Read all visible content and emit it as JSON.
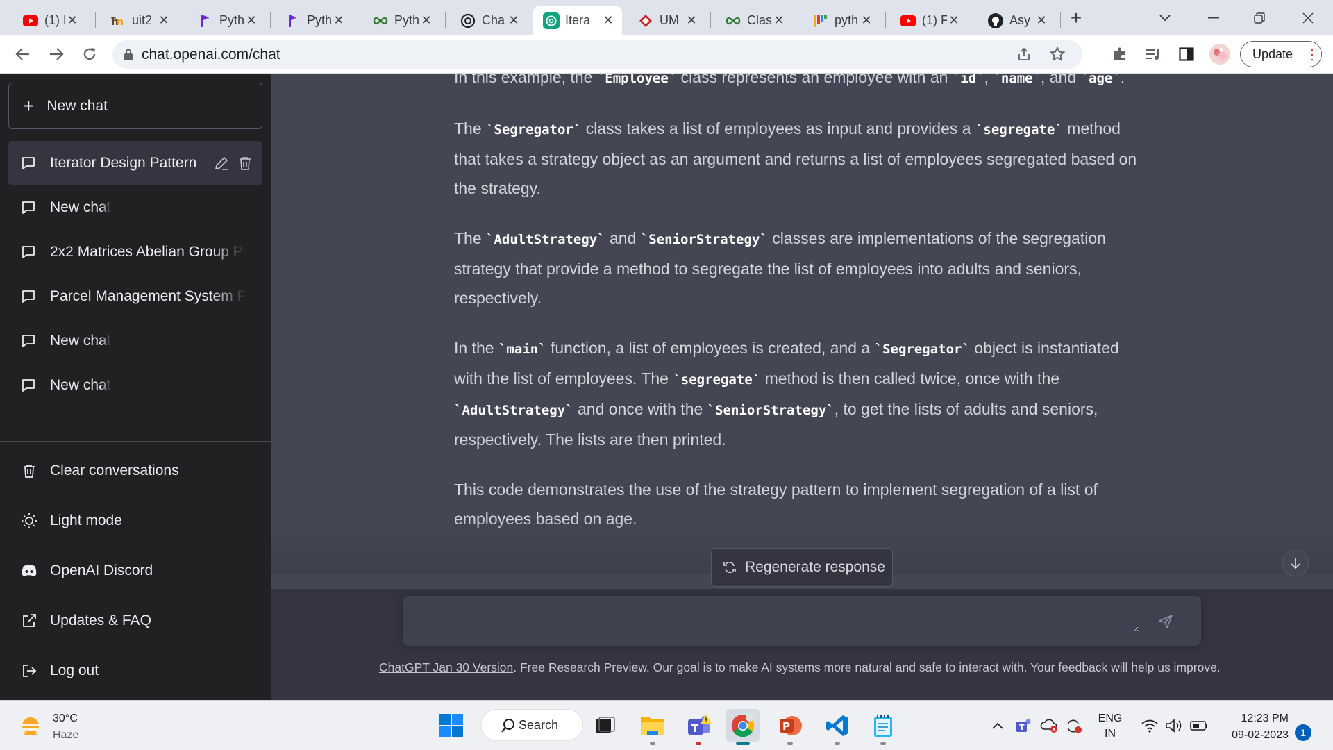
{
  "browser": {
    "tabs": [
      {
        "title": "(1) F",
        "icon": "youtube-icon"
      },
      {
        "title": "uit2",
        "icon": "hugging-face-icon"
      },
      {
        "title": "Pyth",
        "icon": "p-logo-icon"
      },
      {
        "title": "Pyth",
        "icon": "p-logo-icon"
      },
      {
        "title": "Pyth",
        "icon": "infinity-icon"
      },
      {
        "title": "Cha",
        "icon": "openai-icon"
      },
      {
        "title": "Itera",
        "icon": "openai-icon",
        "active": true
      },
      {
        "title": "UM",
        "icon": "diamond-icon"
      },
      {
        "title": "Clas",
        "icon": "infinity-icon"
      },
      {
        "title": "pyth",
        "icon": "colorful-bars-icon"
      },
      {
        "title": "(1) F",
        "icon": "youtube-icon"
      },
      {
        "title": "Asy",
        "icon": "github-icon"
      }
    ],
    "url": "chat.openai.com/chat",
    "update_label": "Update"
  },
  "sidebar": {
    "new_chat_label": "New chat",
    "history": [
      {
        "label": "Iterator Design Pattern",
        "active": true
      },
      {
        "label": "New chat"
      },
      {
        "label": "2x2 Matrices Abelian Group Pr"
      },
      {
        "label": "Parcel Management System Py"
      },
      {
        "label": "New chat"
      },
      {
        "label": "New chat"
      }
    ],
    "options": [
      {
        "label": "Clear conversations",
        "icon": "trash-icon"
      },
      {
        "label": "Light mode",
        "icon": "sun-icon"
      },
      {
        "label": "OpenAI Discord",
        "icon": "discord-icon"
      },
      {
        "label": "Updates & FAQ",
        "icon": "external-link-icon"
      },
      {
        "label": "Log out",
        "icon": "logout-icon"
      }
    ]
  },
  "response": {
    "p0": {
      "a": "In this example, the ",
      "c1": "`Employee`",
      "b": " class represents an employee with an ",
      "c2": "`id`",
      "d": ", ",
      "c3": "`name`",
      "e": ", and ",
      "c4": "`age`",
      "f": "."
    },
    "p1": {
      "a": "The ",
      "c1": "`Segregator`",
      "b": " class takes a list of employees as input and provides a ",
      "c2": "`segregate`",
      "c": " method that takes a strategy object as an argument and returns a list of employees segregated based on the strategy."
    },
    "p2": {
      "a": "The ",
      "c1": "`AdultStrategy`",
      "b": " and ",
      "c2": "`SeniorStrategy`",
      "c": " classes are implementations of the segregation strategy that provide a method to segregate the list of employees into adults and seniors, respectively."
    },
    "p3": {
      "a": "In the ",
      "c1": "`main`",
      "b": " function, a list of employees is created, and a ",
      "c2": "`Segregator`",
      "c": " object is instantiated with the list of employees. The ",
      "c3": "`segregate`",
      "d": " method is then called twice, once with the ",
      "c4": "`AdultStrategy`",
      "e": " and once with the ",
      "c5": "`SeniorStrategy`",
      "f": ", to get the lists of adults and seniors, respectively. The lists are then printed."
    },
    "p4": {
      "a": "This code demonstrates the use of the strategy pattern to implement segregation of a list of employees based on age."
    }
  },
  "composer": {
    "regenerate_label": "Regenerate response",
    "prompt_value": "",
    "footer_link": "ChatGPT Jan 30 Version",
    "footer_text": ". Free Research Preview. Our goal is to make AI systems more natural and safe to interact with. Your feedback will help us improve."
  },
  "taskbar": {
    "temperature": "30°C",
    "weather": "Haze",
    "search_label": "Search",
    "lang_line1": "ENG",
    "lang_line2": "IN",
    "time": "12:23 PM",
    "date": "09-02-2023",
    "notification_count": "1"
  },
  "colors": {
    "sidebar_bg": "#202123",
    "main_bg": "#444654",
    "input_bg": "#40414f",
    "accent_openai": "#10a37f"
  }
}
